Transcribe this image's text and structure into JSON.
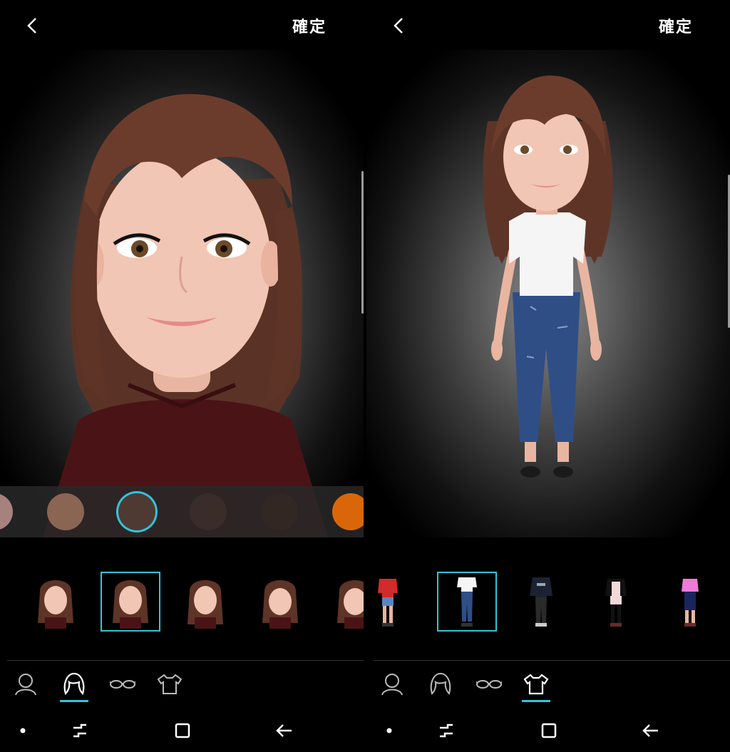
{
  "screens": [
    {
      "id": "hair",
      "top_bar": {
        "back_icon": "chevron-left-icon",
        "confirm_label": "確定"
      },
      "swatches": [
        "#a6817e",
        "#8a6554",
        "#4e3a32",
        "#3a2c28",
        "#332723",
        "#d9670a"
      ],
      "selected_swatch": 2,
      "option_thumbnails": [
        "hair-style-1",
        "hair-style-2",
        "hair-style-3",
        "hair-style-4",
        "hair-style-5"
      ],
      "selected_option": 1,
      "categories": [
        "face-icon",
        "hair-icon",
        "glasses-icon",
        "clothing-icon"
      ],
      "active_category": 1
    },
    {
      "id": "outfit",
      "top_bar": {
        "back_icon": "chevron-left-icon",
        "confirm_label": "確定"
      },
      "option_thumbnails": [
        "outfit-red-top-shorts",
        "outfit-white-tee-jeans",
        "outfit-dark-sweater",
        "outfit-black-jacket",
        "outfit-pink-top"
      ],
      "selected_option": 1,
      "categories": [
        "face-icon",
        "hair-icon",
        "glasses-icon",
        "clothing-icon"
      ],
      "active_category": 3
    }
  ],
  "nav": [
    "dot-icon",
    "recent-apps-icon",
    "home-icon",
    "back-arrow-icon"
  ],
  "colors": {
    "accent": "#33c3dc",
    "background": "#000000"
  }
}
